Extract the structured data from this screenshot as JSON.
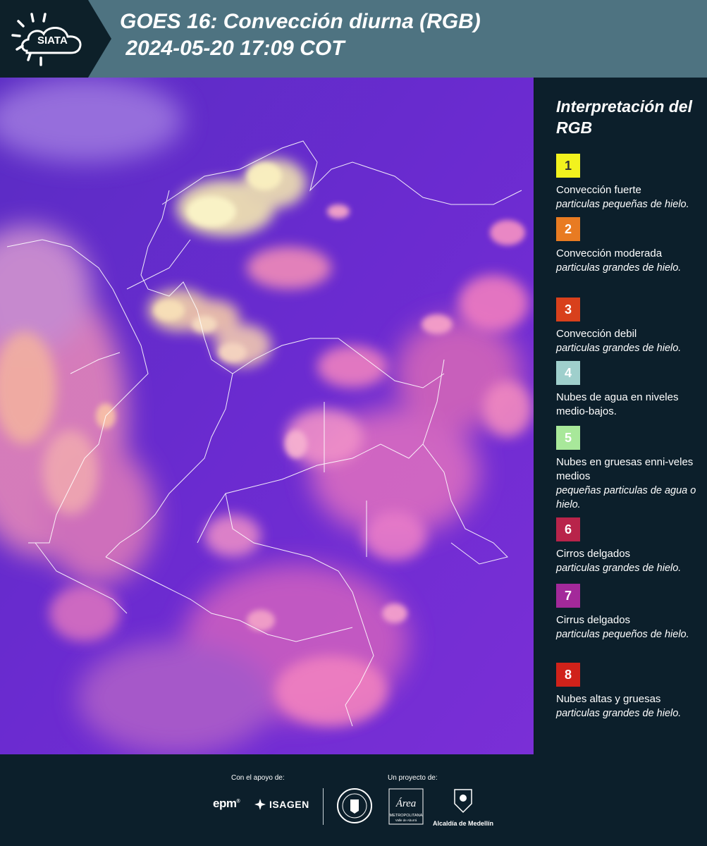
{
  "header": {
    "title": "GOES 16: Convección diurna (RGB)\n 2024-05-20 17:09 COT",
    "logo_text": "SIATA",
    "logo_icon": "sun-cloud-icon"
  },
  "legend": {
    "title": "Interpretación del RGB",
    "items": [
      {
        "number": "1",
        "color": "#f2f21e",
        "text_color": "#333333",
        "label": "Convección fuerte",
        "sub": "particulas pequeñas de hielo."
      },
      {
        "number": "2",
        "color": "#e87b22",
        "text_color": "#ffffff",
        "label": "Convección moderada",
        "sub": "particulas grandes de hielo."
      },
      {
        "number": "3",
        "color": "#d8401c",
        "text_color": "#ffffff",
        "label": "Convección debil",
        "sub": "particulas grandes de hielo."
      },
      {
        "number": "4",
        "color": "#9fcfcc",
        "text_color": "#ffffff",
        "label": "Nubes de agua en niveles medio-bajos.",
        "sub": ""
      },
      {
        "number": "5",
        "color": "#a8e89a",
        "text_color": "#ffffff",
        "label": "Nubes en gruesas enni-veles medios",
        "sub": "pequeñas particulas de agua o hielo."
      },
      {
        "number": "6",
        "color": "#b8244a",
        "text_color": "#ffffff",
        "label": "Cirros delgados",
        "sub": "particulas grandes de hielo."
      },
      {
        "number": "7",
        "color": "#a3299a",
        "text_color": "#ffffff",
        "label": "Cirrus delgados",
        "sub": "particulas pequeños de hielo."
      },
      {
        "number": "8",
        "color": "#d0221a",
        "text_color": "#ffffff",
        "label": "Nubes altas y gruesas",
        "sub": "particulas grandes de hielo."
      }
    ]
  },
  "footer": {
    "support_label": "Con el apoyo de:",
    "project_label": "Un proyecto de:",
    "epm": "epm",
    "isagen": "ISAGEN",
    "area_logo_text": "Área",
    "area_logo_sub": "METROPOLITANA",
    "area_logo_sub2": "Valle de Aburrá",
    "medellin_label": "Alcaldía de Medellín"
  },
  "colors": {
    "header_band": "#4e7381",
    "header_dark": "#0d2029",
    "panel": "#0c1f2b",
    "map_base": "#6a2bc8"
  }
}
